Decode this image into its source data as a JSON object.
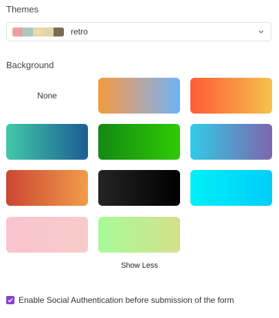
{
  "themes": {
    "label": "Themes",
    "selected": "retro",
    "palette": [
      "#eb9f9f",
      "#a7cbbc",
      "#ecd9a7",
      "#e3d3a6",
      "#7a6b58"
    ]
  },
  "background": {
    "label": "Background",
    "none_label": "None",
    "options": [
      {
        "gradient": "linear-gradient(90deg, #f39a3e 0%, #b9a59e 50%, #6eb4f7 100%)"
      },
      {
        "gradient": "linear-gradient(90deg, #ff5a36 0%, #f5c24d 100%)"
      },
      {
        "gradient": "linear-gradient(90deg, #42c9a8 0%, #1b5d94 100%)"
      },
      {
        "gradient": "linear-gradient(90deg, #138a13 0%, #2ecb05 100%)"
      },
      {
        "gradient": "linear-gradient(90deg, #32cbe8 0%, #7c66ab 100%)"
      },
      {
        "gradient": "linear-gradient(90deg, #cc4633 0%, #f29b4a 100%)"
      },
      {
        "gradient": "linear-gradient(90deg, #242424 0%, #000000 100%)"
      },
      {
        "gradient": "linear-gradient(90deg, #00f0f8 0%, #00cdfa 100%)"
      },
      {
        "gradient": "linear-gradient(90deg, #fac3cf 0%, #f7cbc8 100%)"
      },
      {
        "gradient": "linear-gradient(90deg, #a8fa98 0%, #d4e08a 100%)"
      }
    ]
  },
  "show_less_label": "Show Less",
  "social_auth": {
    "checked": true,
    "label": "Enable Social Authentication before submission of the form",
    "color": "#8a3fd6"
  }
}
